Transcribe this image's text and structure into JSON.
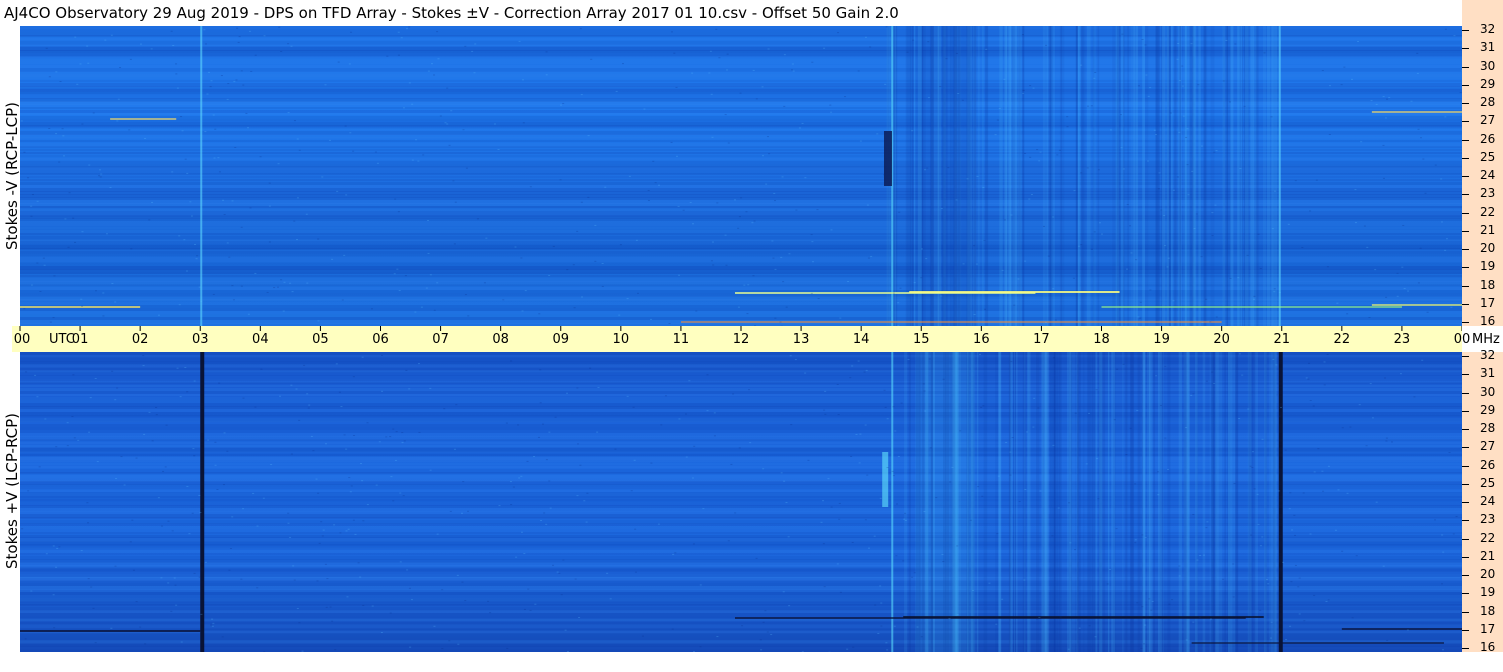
{
  "header": {
    "title": "AJ4CO Observatory  29 Aug 2019  -  DPS on TFD Array  -  Stokes ±V  -  Correction Array 2017 01 10.csv  -  Offset 50  Gain 2.0"
  },
  "panels": {
    "top": {
      "label": "Stokes -V (RCP-LCP)"
    },
    "bottom": {
      "label": "Stokes +V (LCP-RCP)"
    }
  },
  "time_axis": {
    "ticks": [
      "00",
      "01",
      "02",
      "03",
      "04",
      "05",
      "06",
      "07",
      "08",
      "09",
      "10",
      "11",
      "12",
      "13",
      "14",
      "15",
      "16",
      "17",
      "18",
      "19",
      "20",
      "21",
      "22",
      "23",
      "00"
    ],
    "unit": "UTC"
  },
  "freq_axis": {
    "ticks": [
      "32",
      "31",
      "30",
      "29",
      "28",
      "27",
      "26",
      "25",
      "24",
      "23",
      "22",
      "21",
      "20",
      "19",
      "18",
      "17",
      "16"
    ],
    "unit": "MHz"
  },
  "colors": {
    "background_blue": "#1f73e6",
    "time_strip": "#ffffc0",
    "freq_strip": "#ffdfc4"
  },
  "chart_data": {
    "type": "heatmap",
    "title": "AJ4CO Observatory  29 Aug 2019  -  DPS on TFD Array  -  Stokes ±V  -  Correction Array 2017 01 10.csv  -  Offset 50  Gain 2.0",
    "xlabel": "UTC",
    "x_range": [
      0,
      24
    ],
    "y_range": [
      16,
      32
    ],
    "yunit": "MHz",
    "panels": [
      "Stokes -V (RCP-LCP)",
      "Stokes +V (LCP-RCP)"
    ]
  }
}
